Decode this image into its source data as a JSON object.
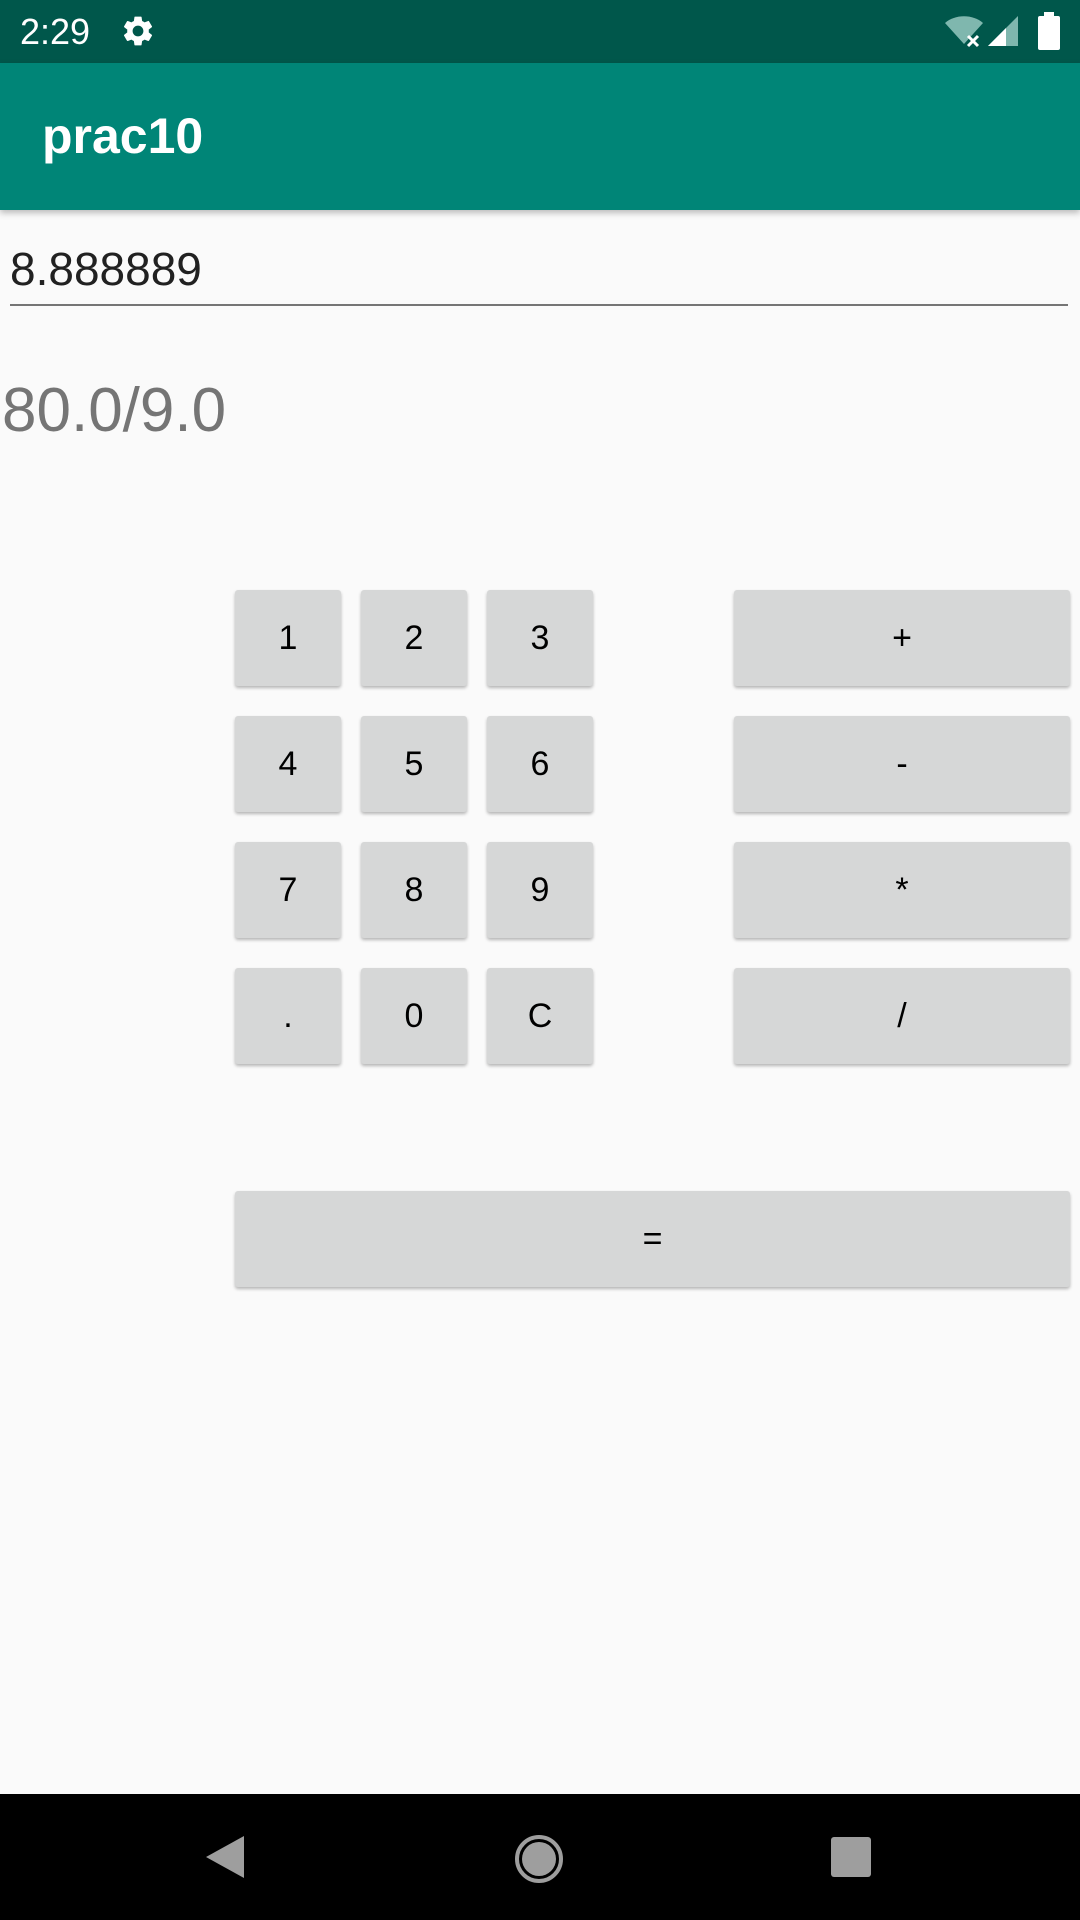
{
  "status_bar": {
    "time": "2:29",
    "icons": [
      "gear-icon",
      "wifi-icon",
      "signal-icon",
      "battery-icon"
    ]
  },
  "app_bar": {
    "title": "prac10"
  },
  "input": {
    "value": "8.888889"
  },
  "expression": "80.0/9.0",
  "keypad": {
    "digits": [
      "1",
      "2",
      "3",
      "4",
      "5",
      "6",
      "7",
      "8",
      "9",
      ".",
      "0",
      "C"
    ],
    "operators": [
      "+",
      "-",
      "*",
      "/"
    ],
    "equals": "="
  },
  "nav_bar": {
    "icons": [
      "back-icon",
      "home-icon",
      "recents-icon"
    ]
  },
  "colors": {
    "status_bar": "#00574b",
    "app_bar": "#008577",
    "background": "#fafafa",
    "button": "#d6d7d7",
    "nav_bar": "#000000"
  }
}
